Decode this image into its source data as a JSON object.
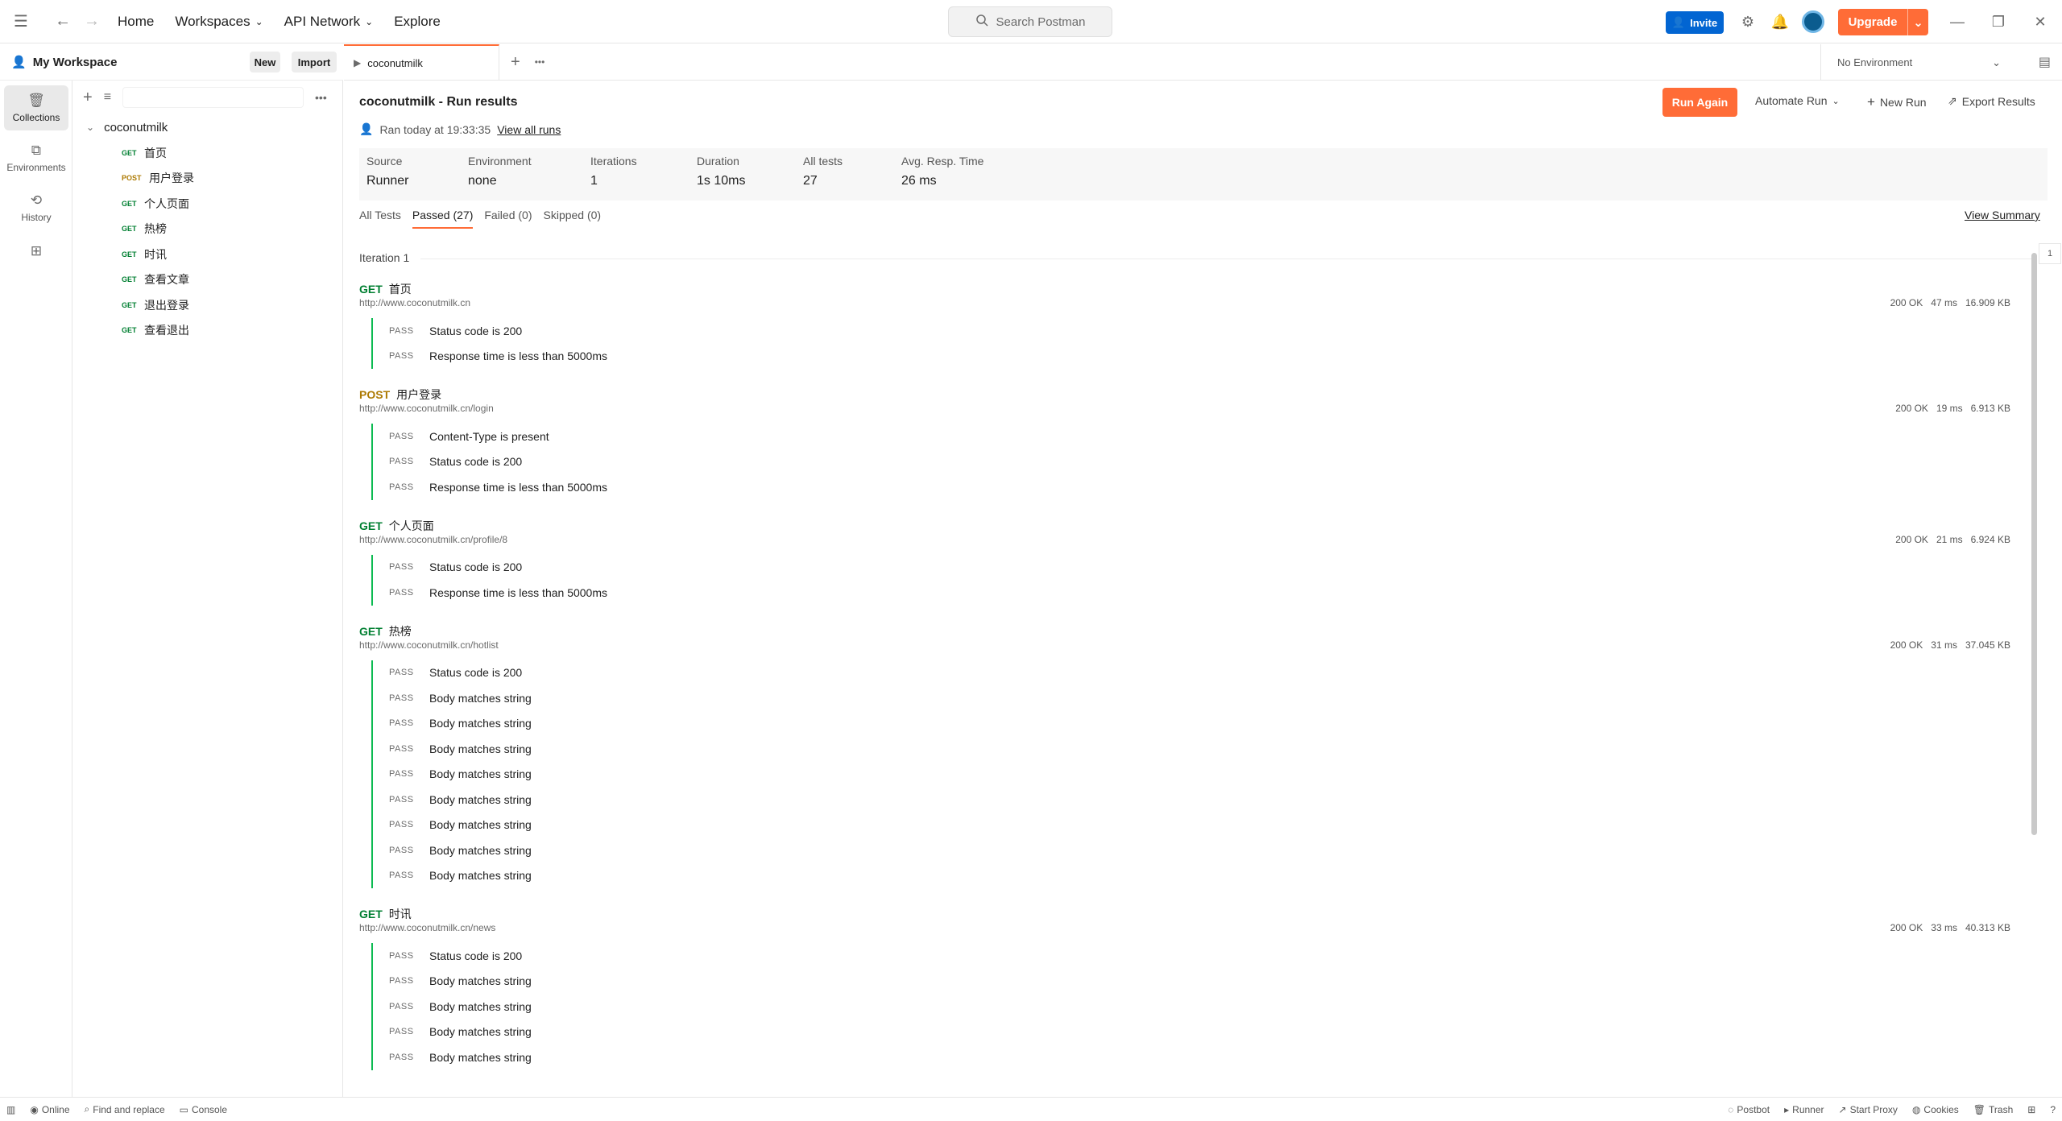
{
  "topbar": {
    "nav": {
      "home": "Home",
      "workspaces": "Workspaces",
      "api_network": "API Network",
      "explore": "Explore"
    },
    "search_placeholder": "Search Postman",
    "invite": "Invite",
    "upgrade": "Upgrade"
  },
  "workspace": {
    "name": "My Workspace",
    "new": "New",
    "import": "Import"
  },
  "rail": [
    {
      "label": "Collections",
      "icon": "trash-bin-icon"
    },
    {
      "label": "Environments",
      "icon": "environment-icon"
    },
    {
      "label": "History",
      "icon": "history-icon"
    }
  ],
  "collection": {
    "name": "coconutmilk",
    "items": [
      {
        "method": "GET",
        "name": "首页"
      },
      {
        "method": "POST",
        "name": "用户登录"
      },
      {
        "method": "GET",
        "name": "个人页面"
      },
      {
        "method": "GET",
        "name": "热榜"
      },
      {
        "method": "GET",
        "name": "时讯"
      },
      {
        "method": "GET",
        "name": "查看文章"
      },
      {
        "method": "GET",
        "name": "退出登录"
      },
      {
        "method": "GET",
        "name": "查看退出"
      }
    ]
  },
  "tab": {
    "label": "coconutmilk"
  },
  "environment": "No Environment",
  "run": {
    "title": "coconutmilk - Run results",
    "ran_at": "Ran today at 19:33:35",
    "view_all": "View all runs",
    "run_again": "Run Again",
    "automate": "Automate Run",
    "new_run": "New Run",
    "export": "Export Results",
    "summary": [
      {
        "key": "Source",
        "value": "Runner"
      },
      {
        "key": "Environment",
        "value": "none"
      },
      {
        "key": "Iterations",
        "value": "1"
      },
      {
        "key": "Duration",
        "value": "1s 10ms"
      },
      {
        "key": "All tests",
        "value": "27"
      },
      {
        "key": "Avg. Resp. Time",
        "value": "26 ms"
      }
    ],
    "filters": [
      "All Tests",
      "Passed (27)",
      "Failed (0)",
      "Skipped (0)"
    ],
    "view_summary": "View Summary",
    "iteration": "Iteration 1",
    "page": "1"
  },
  "requests": [
    {
      "method": "GET",
      "name": "首页",
      "url": "http://www.coconutmilk.cn",
      "status": "200 OK",
      "time": "47 ms",
      "size": "16.909 KB",
      "tests": [
        "Status code is 200",
        "Response time is less than 5000ms"
      ]
    },
    {
      "method": "POST",
      "name": "用户登录",
      "url": "http://www.coconutmilk.cn/login",
      "status": "200 OK",
      "time": "19 ms",
      "size": "6.913 KB",
      "tests": [
        "Content-Type is present",
        "Status code is 200",
        "Response time is less than 5000ms"
      ]
    },
    {
      "method": "GET",
      "name": "个人页面",
      "url": "http://www.coconutmilk.cn/profile/8",
      "status": "200 OK",
      "time": "21 ms",
      "size": "6.924 KB",
      "tests": [
        "Status code is 200",
        "Response time is less than 5000ms"
      ]
    },
    {
      "method": "GET",
      "name": "热榜",
      "url": "http://www.coconutmilk.cn/hotlist",
      "status": "200 OK",
      "time": "31 ms",
      "size": "37.045 KB",
      "tests": [
        "Status code is 200",
        "Body matches string",
        "Body matches string",
        "Body matches string",
        "Body matches string",
        "Body matches string",
        "Body matches string",
        "Body matches string",
        "Body matches string"
      ]
    },
    {
      "method": "GET",
      "name": "时讯",
      "url": "http://www.coconutmilk.cn/news",
      "status": "200 OK",
      "time": "33 ms",
      "size": "40.313 KB",
      "tests": [
        "Status code is 200",
        "Body matches string",
        "Body matches string",
        "Body matches string",
        "Body matches string"
      ]
    }
  ],
  "pass_label": "PASS",
  "statusbar": {
    "online": "Online",
    "find_replace": "Find and replace",
    "console": "Console",
    "postbot": "Postbot",
    "runner": "Runner",
    "proxy": "Start Proxy",
    "cookies": "Cookies",
    "trash": "Trash"
  },
  "colors": {
    "accent": "#ff6c37",
    "get": "#007f31",
    "post": "#ad7a03",
    "pass_bar": "#0cbb52",
    "invite": "#0265d2"
  }
}
